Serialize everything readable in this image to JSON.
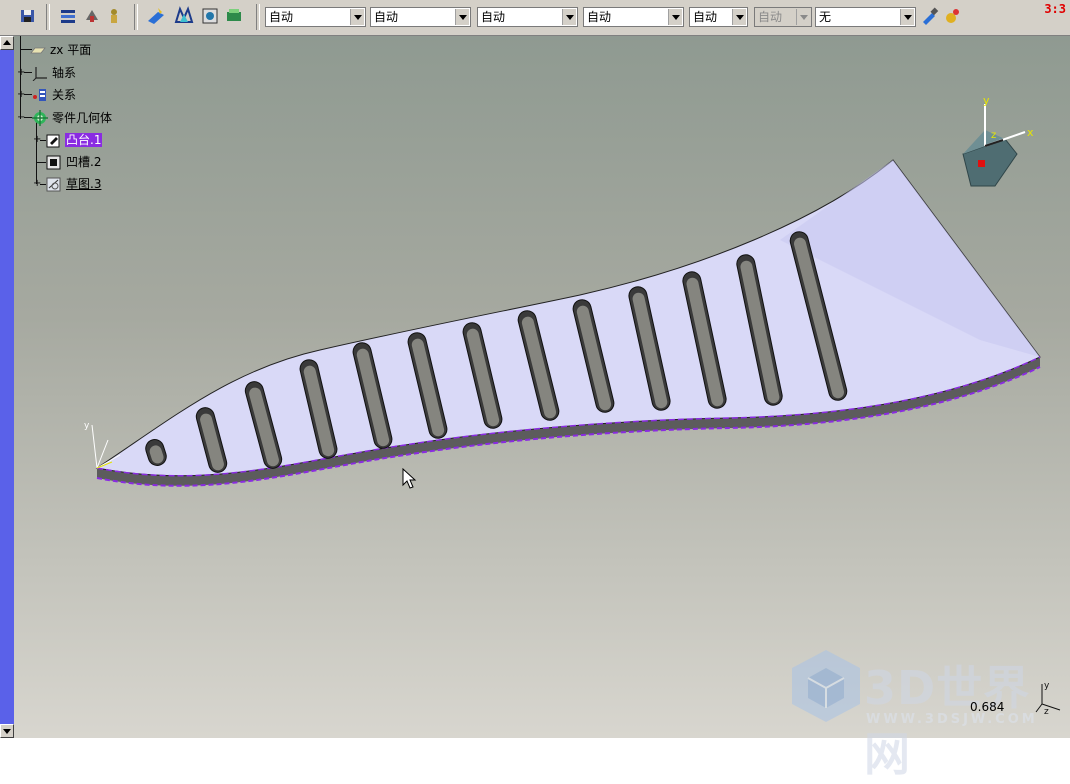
{
  "toolbar": {
    "combos": [
      {
        "value": "自动"
      },
      {
        "value": "自动"
      },
      {
        "value": "自动"
      },
      {
        "value": "自动"
      },
      {
        "value": "自动"
      },
      {
        "value": "自动",
        "disabled": true
      },
      {
        "value": "无"
      }
    ],
    "corner_label": "3:3"
  },
  "tree": {
    "items": [
      {
        "label": "zx 平面",
        "icon": "plane-icon"
      },
      {
        "label": "轴系",
        "icon": "axis-system-icon"
      },
      {
        "label": "关系",
        "icon": "relations-icon"
      },
      {
        "label": "零件几何体",
        "icon": "part-body-icon"
      },
      {
        "label": "凸台.1",
        "icon": "pad-icon",
        "selected": true
      },
      {
        "label": "凹槽.2",
        "icon": "pocket-icon"
      },
      {
        "label": "草图.3",
        "icon": "sketch-icon"
      }
    ]
  },
  "compass": {
    "x_label": "x",
    "y_label": "y",
    "z_label": "z"
  },
  "watermark": {
    "brand": "3D世界网",
    "url": "WWW.3DSJW.COM"
  },
  "status": {
    "zoom": "0.684"
  },
  "colors": {
    "selection": "#8a2be2",
    "part_face": "#d8d8f4",
    "slot_wall": "#7c7c78",
    "scrollbar": "#5a61e9"
  }
}
